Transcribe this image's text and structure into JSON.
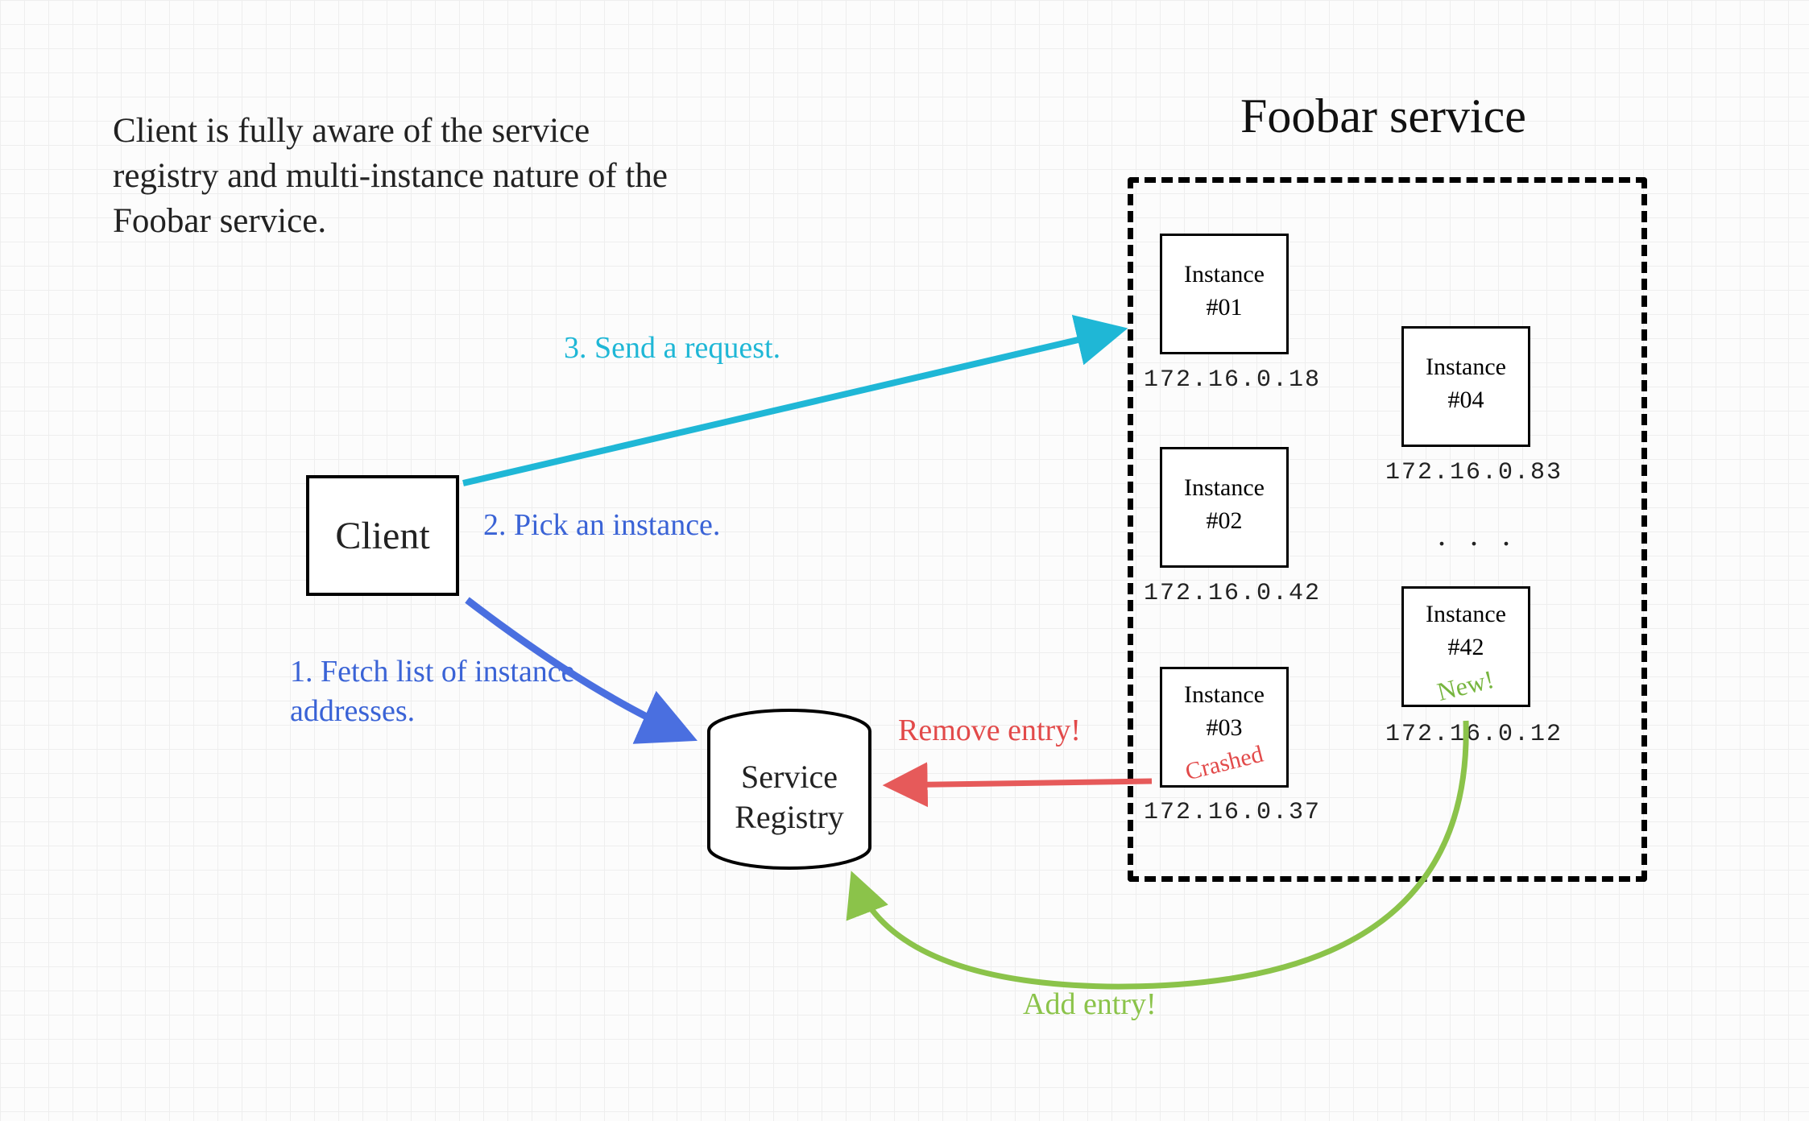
{
  "description": "Client is fully aware of the service registry and multi-instance nature of the Foobar service.",
  "client": {
    "label": "Client"
  },
  "registry": {
    "line1": "Service",
    "line2": "Registry"
  },
  "service": {
    "title": "Foobar service"
  },
  "instances": {
    "i01": {
      "line1": "Instance",
      "line2": "#01",
      "ip": "172.16.0.18"
    },
    "i02": {
      "line1": "Instance",
      "line2": "#02",
      "ip": "172.16.0.42"
    },
    "i03": {
      "line1": "Instance",
      "line2": "#03",
      "ip": "172.16.0.37",
      "status": "Crashed"
    },
    "i04": {
      "line1": "Instance",
      "line2": "#04",
      "ip": "172.16.0.83"
    },
    "i42": {
      "line1": "Instance",
      "line2": "#42",
      "ip": "172.16.0.12",
      "status": "New!"
    }
  },
  "dots": ". . .",
  "steps": {
    "step1": "1. Fetch list of instance addresses.",
    "step2": "2. Pick an instance.",
    "step3": "3. Send a request."
  },
  "actions": {
    "remove": "Remove entry!",
    "add": "Add entry!"
  },
  "colors": {
    "grid": "#eeeeee",
    "blue": "#3a63d6",
    "cyan": "#1fb7d6",
    "red": "#e24a4a",
    "green": "#8bc34a",
    "black": "#000000"
  }
}
